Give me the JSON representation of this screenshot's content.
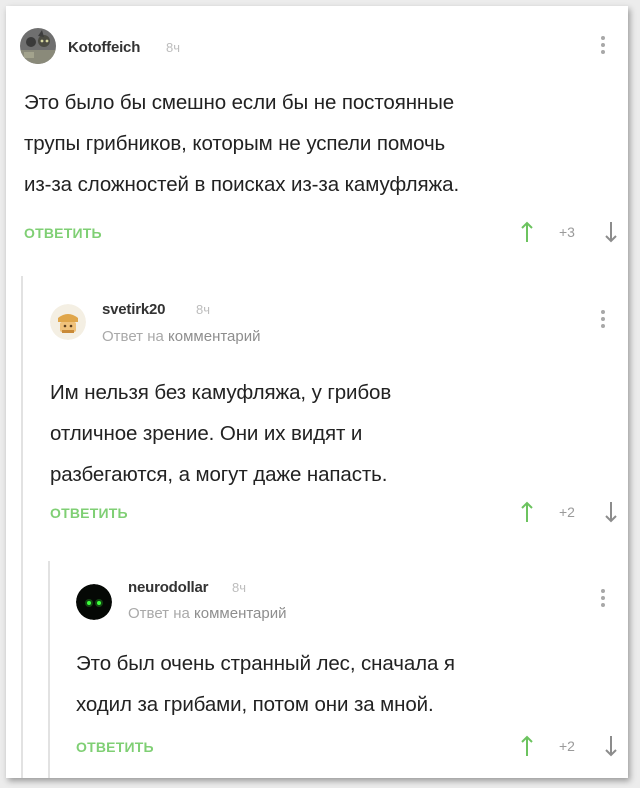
{
  "comments": [
    {
      "username": "Kotoffeich",
      "time": "8ч",
      "reply_prefix": "",
      "reply_target": "",
      "body_lines": [
        "Это было бы смешно если бы не постоянные",
        "трупы грибников, которым не успели помочь",
        "из-за сложностей в поисках из-за камуфляжа."
      ],
      "reply_label": "ОТВЕТИТЬ",
      "score": "+3"
    },
    {
      "username": "svetirk20",
      "time": "8ч",
      "reply_prefix": "Ответ на",
      "reply_target": "комментарий",
      "body_lines": [
        "Им нельзя без камуфляжа, у грибов",
        "отличное зрение. Они их видят и",
        "разбегаются, а могут даже напасть."
      ],
      "reply_label": "ОТВЕТИТЬ",
      "score": "+2"
    },
    {
      "username": "neurodollar",
      "time": "8ч",
      "reply_prefix": "Ответ на",
      "reply_target": "комментарий",
      "body_lines": [
        "Это был очень странный лес, сначала я",
        "ходил за грибами, потом они за мной."
      ],
      "reply_label": "ОТВЕТИТЬ",
      "score": "+2"
    }
  ],
  "icons": {
    "avatar_1": "cat-avatar-icon",
    "avatar_2": "hat-avatar-icon",
    "avatar_3": "glowing-eyes-avatar-icon",
    "upvote": "arrow-up-icon",
    "downvote": "arrow-down-icon",
    "menu": "more-vertical-icon"
  },
  "colors": {
    "reply_button": "#7fcf74",
    "upvote_arrow": "#6cc35f",
    "downvote_arrow": "#8c8c8c",
    "thread_line": "#e2e2e2"
  }
}
